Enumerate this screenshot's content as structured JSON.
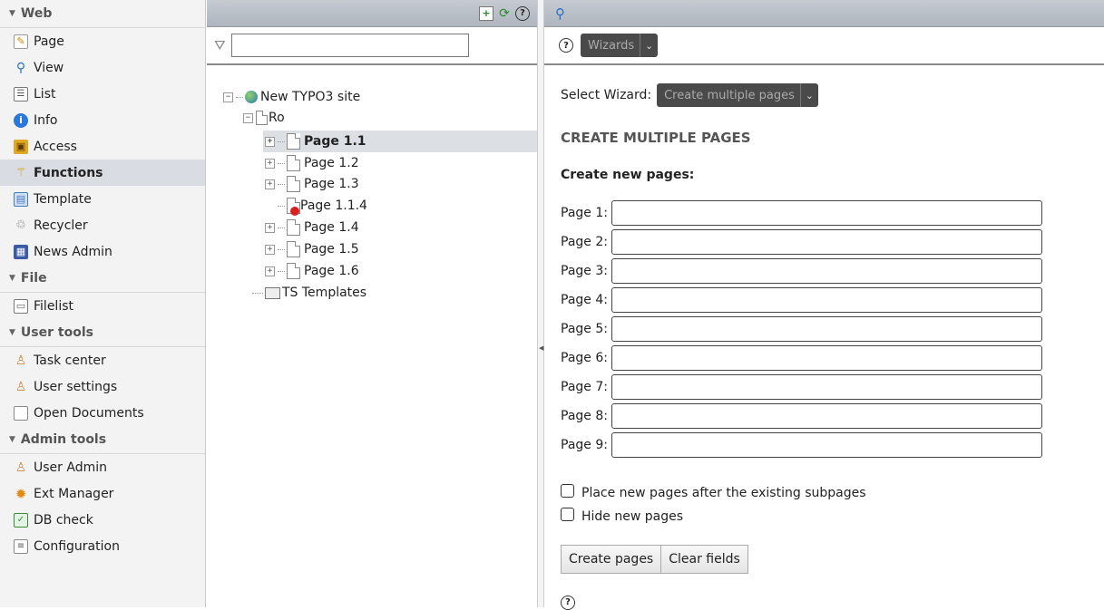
{
  "menu": {
    "sections": [
      {
        "title": "Web",
        "items": [
          {
            "label": "Page",
            "icon": "page-edit-icon"
          },
          {
            "label": "View",
            "icon": "magnifier-icon"
          },
          {
            "label": "List",
            "icon": "list-icon"
          },
          {
            "label": "Info",
            "icon": "info-icon"
          },
          {
            "label": "Access",
            "icon": "lock-icon"
          },
          {
            "label": "Functions",
            "icon": "wand-icon",
            "active": true
          },
          {
            "label": "Template",
            "icon": "template-icon"
          },
          {
            "label": "Recycler",
            "icon": "recycler-icon"
          },
          {
            "label": "News Admin",
            "icon": "news-icon"
          }
        ]
      },
      {
        "title": "File",
        "items": [
          {
            "label": "Filelist",
            "icon": "filelist-icon"
          }
        ]
      },
      {
        "title": "User tools",
        "items": [
          {
            "label": "Task center",
            "icon": "task-icon"
          },
          {
            "label": "User settings",
            "icon": "user-settings-icon"
          },
          {
            "label": "Open Documents",
            "icon": "document-icon"
          }
        ]
      },
      {
        "title": "Admin tools",
        "items": [
          {
            "label": "User Admin",
            "icon": "user-admin-icon"
          },
          {
            "label": "Ext Manager",
            "icon": "ext-manager-icon"
          },
          {
            "label": "DB check",
            "icon": "db-check-icon"
          },
          {
            "label": "Configuration",
            "icon": "configuration-icon"
          }
        ]
      }
    ]
  },
  "tree": {
    "root": "New TYPO3 site",
    "ro": "Ro",
    "nodes": [
      "Page 1.1",
      "Page 1.2",
      "Page 1.3",
      "Page 1.1.4",
      "Page 1.4",
      "Page 1.5",
      "Page 1.6"
    ],
    "ts_templates": "TS Templates"
  },
  "content": {
    "wizards_label": "Wizards",
    "select_wizard_label": "Select Wizard:",
    "select_wizard_value": "Create multiple pages",
    "heading": "CREATE MULTIPLE PAGES",
    "subheading": "Create new pages:",
    "page_labels": [
      "Page 1:",
      "Page 2:",
      "Page 3:",
      "Page 4:",
      "Page 5:",
      "Page 6:",
      "Page 7:",
      "Page 8:",
      "Page 9:"
    ],
    "opt_after": "Place new pages after the existing subpages",
    "opt_hide": "Hide new pages",
    "btn_create": "Create pages",
    "btn_clear": "Clear fields"
  }
}
